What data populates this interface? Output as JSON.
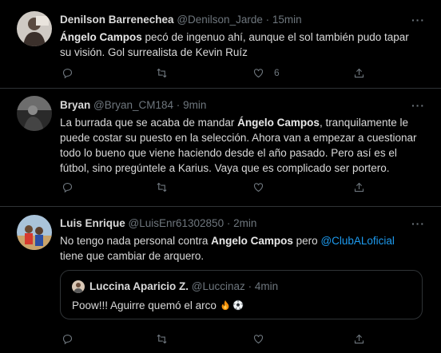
{
  "colors": {
    "background": "#000000",
    "text": "#d9d9d9",
    "muted": "#6e767d",
    "link": "#1d9bf0",
    "divider": "#2f3336"
  },
  "tweets": [
    {
      "name": "Denilson Barrenechea",
      "handle": "@Denilson_Jarde",
      "dot": "·",
      "time": "15min",
      "more": "···",
      "text_parts": [
        "Ángelo Campos",
        " pecó de ingenuo ahí, aunque el sol también pudo tapar su visión. Gol surrealista de Kevin Ruíz"
      ],
      "like_count": "6"
    },
    {
      "name": "Bryan",
      "handle": "@Bryan_CM184",
      "dot": "·",
      "time": "9min",
      "more": "···",
      "text_parts": [
        "La burrada que se acaba de mandar ",
        "Ángelo Campos",
        ", tranquilamente le puede costar su puesto en la selección. Ahora van a empezar a cuestionar todo lo bueno que viene haciendo desde el año pasado. Pero así es el fútbol, sino pregúntele a Karius. Vaya que es complicado ser portero."
      ]
    },
    {
      "name": "Luis Enrique",
      "handle": "@LuisEnr61302850",
      "dot": "·",
      "time": "2min",
      "more": "···",
      "text_parts": [
        "No tengo nada personal contra ",
        "Angelo Campos",
        " pero ",
        "@ClubALoficial",
        " tiene que cambiar de arquero."
      ],
      "quote": {
        "name": "Luccina Aparicio Z.",
        "handle": "@Luccinaz",
        "dot": "·",
        "time": "4min",
        "text": "Poow!!! Aguirre quemó el arco "
      }
    }
  ],
  "icons": [
    "reply-icon",
    "retweet-icon",
    "like-icon",
    "share-icon",
    "fire-emoji",
    "soccer-ball-emoji"
  ]
}
